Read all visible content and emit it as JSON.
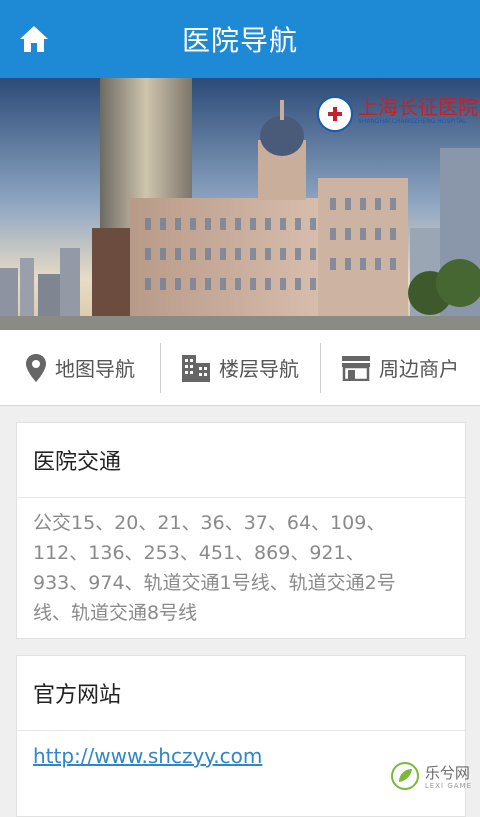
{
  "header": {
    "title": "医院导航",
    "home_icon": "home-icon"
  },
  "hero": {
    "logo_text": "上海长征医院",
    "logo_sub": "SHANGHAI CHANGZHENG HOSPITAL"
  },
  "nav": [
    {
      "label": "地图导航",
      "icon": "location-pin-icon"
    },
    {
      "label": "楼层导航",
      "icon": "building-icon"
    },
    {
      "label": "周边商户",
      "icon": "storefront-icon"
    }
  ],
  "transport": {
    "title": "医院交通",
    "lines": [
      "公交15、20、21、36、37、64、109、",
      "112、136、253、451、869、921、",
      "933、974、轨道交通1号线、轨道交通2号",
      "线、轨道交通8号线"
    ]
  },
  "website": {
    "title": "官方网站",
    "url": "http://www.shczyy.com"
  },
  "watermark": {
    "text": "乐兮网",
    "sub": "LEXI GAME"
  },
  "colors": {
    "accent": "#1e8ad6",
    "link": "#2f86c8"
  }
}
